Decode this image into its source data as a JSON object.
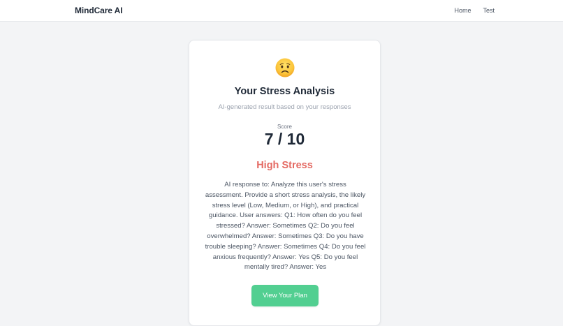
{
  "nav": {
    "brand": "MindCare AI",
    "links": [
      "Home",
      "Test"
    ]
  },
  "result": {
    "emoji_icon": "worried-face-emoji",
    "title": "Your Stress Analysis",
    "subtitle": "AI-generated result based on your responses",
    "score_label": "Score",
    "score": "7 / 10",
    "level": "High Stress",
    "level_color": "#e46a63",
    "response_text": "AI response to: Analyze this user's stress assessment. Provide a short stress analysis, the likely stress level (Low, Medium, or High), and practical guidance. User answers: Q1: How often do you feel stressed? Answer: Sometimes Q2: Do you feel overwhelmed? Answer: Sometimes Q3: Do you have trouble sleeping? Answer: Sometimes Q4: Do you feel anxious frequently? Answer: Yes Q5: Do you feel mentally tired? Answer: Yes",
    "button_label": "View Your Plan",
    "button_color": "#52cf91"
  }
}
